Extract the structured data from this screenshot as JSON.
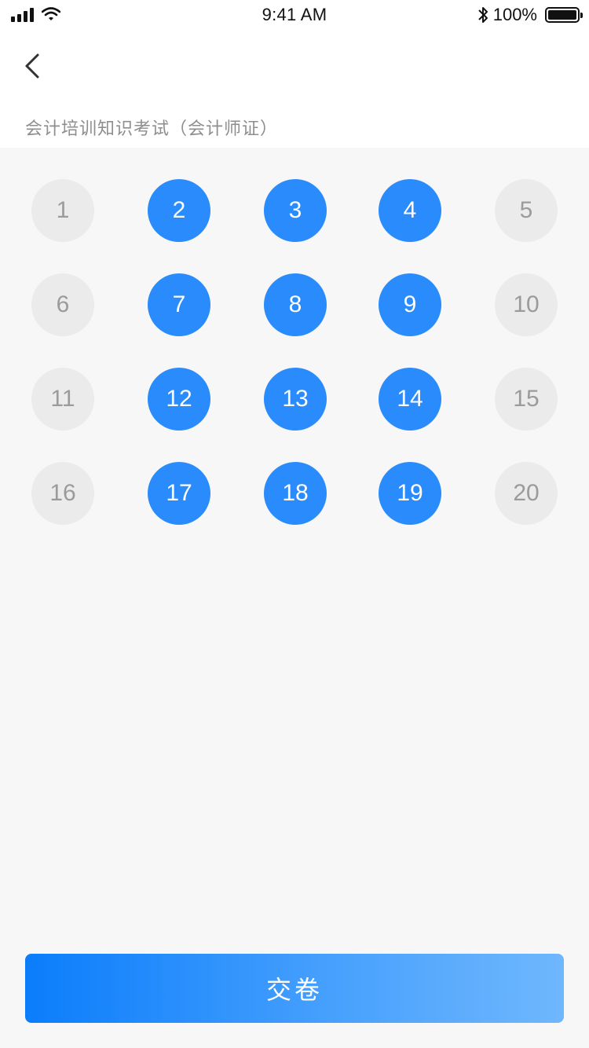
{
  "status_bar": {
    "time": "9:41 AM",
    "battery": "100%",
    "icons": [
      "signal-icon",
      "wifi-icon",
      "bluetooth-icon",
      "battery-icon"
    ]
  },
  "header": {
    "back_icon": "chevron-left-icon",
    "title": "会计培训知识考试（会计师证）"
  },
  "questions": [
    {
      "label": "1",
      "status": "unanswered"
    },
    {
      "label": "2",
      "status": "answered"
    },
    {
      "label": "3",
      "status": "answered"
    },
    {
      "label": "4",
      "status": "answered"
    },
    {
      "label": "5",
      "status": "unanswered"
    },
    {
      "label": "6",
      "status": "unanswered"
    },
    {
      "label": "7",
      "status": "answered"
    },
    {
      "label": "8",
      "status": "answered"
    },
    {
      "label": "9",
      "status": "answered"
    },
    {
      "label": "10",
      "status": "unanswered"
    },
    {
      "label": "11",
      "status": "unanswered"
    },
    {
      "label": "12",
      "status": "answered"
    },
    {
      "label": "13",
      "status": "answered"
    },
    {
      "label": "14",
      "status": "answered"
    },
    {
      "label": "15",
      "status": "unanswered"
    },
    {
      "label": "16",
      "status": "unanswered"
    },
    {
      "label": "17",
      "status": "answered"
    },
    {
      "label": "18",
      "status": "answered"
    },
    {
      "label": "19",
      "status": "answered"
    },
    {
      "label": "20",
      "status": "unanswered"
    }
  ],
  "colors": {
    "answered": "#2a8bfd",
    "unanswered": "#ebebeb",
    "unanswered_text": "#9b9b9b",
    "background": "#f7f7f7"
  },
  "submit": {
    "label": "交卷"
  }
}
